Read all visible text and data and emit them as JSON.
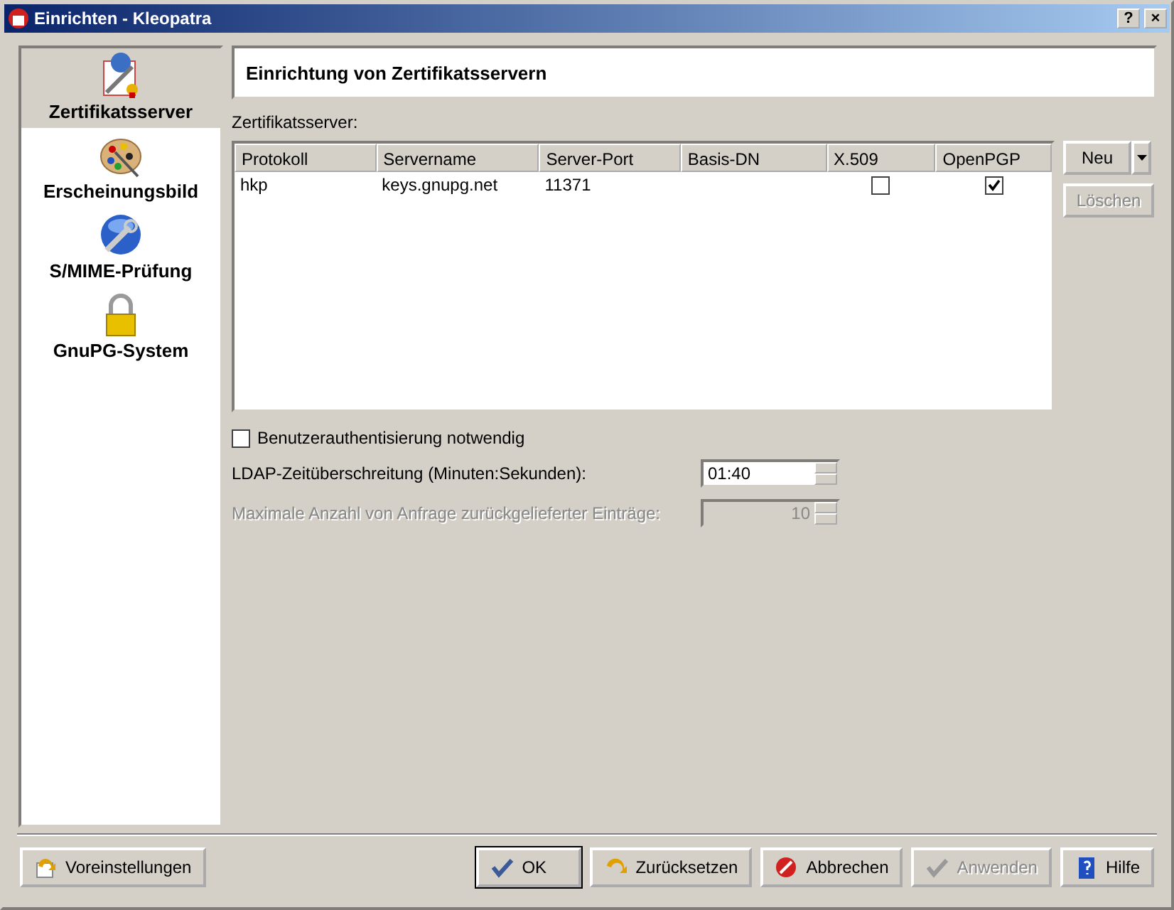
{
  "window": {
    "title": "Einrichten - Kleopatra",
    "help_button": "?",
    "close_button": "×"
  },
  "sidebar": {
    "items": [
      {
        "label": "Zertifikatsserver",
        "selected": true
      },
      {
        "label": "Erscheinungsbild",
        "selected": false
      },
      {
        "label": "S/MIME-Prüfung",
        "selected": false
      },
      {
        "label": "GnuPG-System",
        "selected": false
      }
    ]
  },
  "page": {
    "title": "Einrichtung von Zertifikatsservern",
    "servers_label": "Zertifikatsserver:",
    "table": {
      "columns": [
        "Protokoll",
        "Servername",
        "Server-Port",
        "Basis-DN",
        "X.509",
        "OpenPGP"
      ],
      "rows": [
        {
          "protocol": "hkp",
          "server": "keys.gnupg.net",
          "port": "11371",
          "x509": false,
          "openpgp": true
        }
      ]
    },
    "new_button": {
      "label": "Neu",
      "disabled": false
    },
    "delete_button": {
      "label": "Löschen",
      "disabled": true
    },
    "auth": {
      "label": "Benutzerauthentisierung notwendig",
      "checked": false
    },
    "timeout": {
      "label": "LDAP-Zeitüberschreitung (Minuten:Sekunden):",
      "value": "01:40",
      "disabled": false
    },
    "max_items": {
      "label": "Maximale Anzahl von Anfrage zurückgelieferter Einträge:",
      "value": "10",
      "disabled": true
    }
  },
  "footer": {
    "buttons": [
      {
        "label": "Voreinstellungen",
        "disabled": false,
        "default": false
      },
      {
        "label": "OK",
        "disabled": false,
        "default": true
      },
      {
        "label": "Zurücksetzen",
        "disabled": false,
        "default": false
      },
      {
        "label": "Abbrechen",
        "disabled": false,
        "default": false
      },
      {
        "label": "Anwenden",
        "disabled": true,
        "default": false
      },
      {
        "label": "Hilfe",
        "disabled": false,
        "default": false
      }
    ]
  }
}
